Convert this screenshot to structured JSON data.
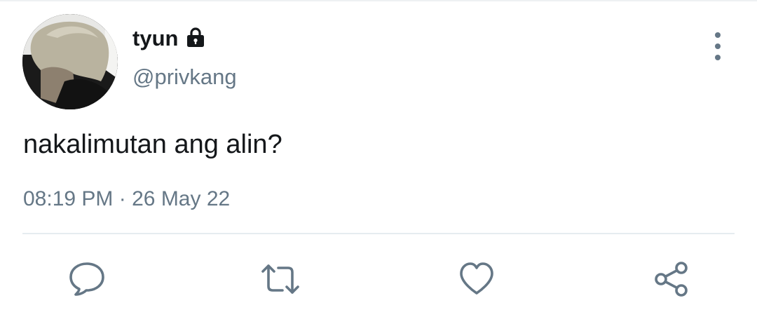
{
  "tweet": {
    "display_name": "tyun",
    "handle": "@privkang",
    "protected_icon": "lock-icon",
    "text": "nakalimutan ang alin?",
    "time": "08:19 PM",
    "separator": "·",
    "date": "26 May 22"
  },
  "actions": {
    "reply_icon": "speech-bubble-icon",
    "retweet_icon": "retweet-icon",
    "like_icon": "heart-icon",
    "share_icon": "share-icon",
    "more_icon": "vertical-ellipsis-icon"
  },
  "colors": {
    "text_primary": "#14171a",
    "text_secondary": "#657786",
    "divider": "#e6ecf0"
  }
}
